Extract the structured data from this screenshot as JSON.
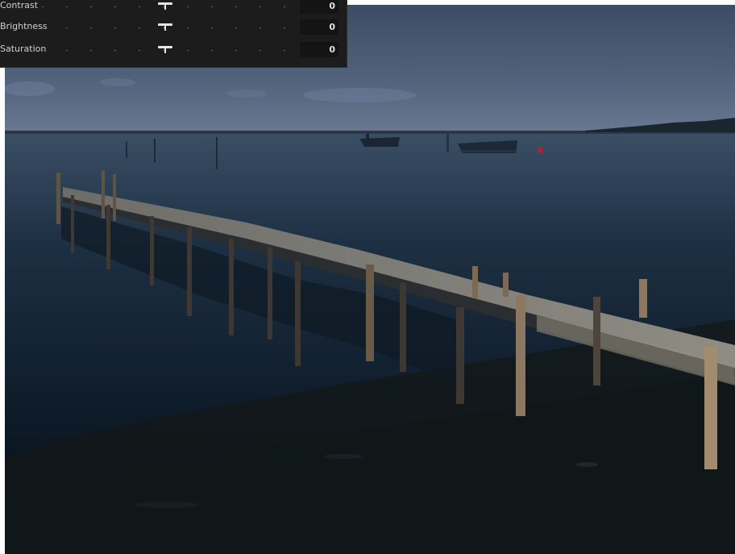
{
  "photo": {
    "description_icon": "lake-pier-photo"
  },
  "adjustments": [
    {
      "label": "Contrast",
      "value": "0",
      "level": 0.5
    },
    {
      "label": "Brightness",
      "value": "0",
      "level": 0.5
    },
    {
      "label": "Saturation",
      "value": "0",
      "level": 0.5
    }
  ],
  "colors": {
    "panel_bg": "#1c1c1c",
    "slider_thumb": "#e6e6e6",
    "value_box": "#141414"
  }
}
